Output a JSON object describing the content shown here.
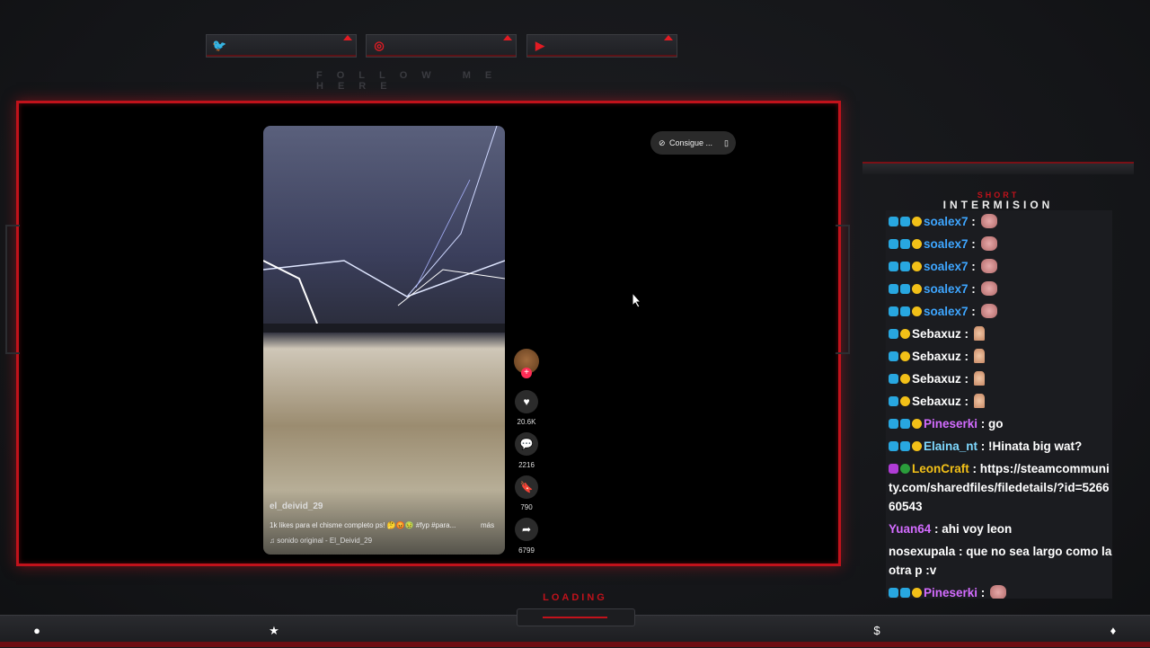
{
  "overlay": {
    "follow_text": "FOLLOW ME HERE",
    "loading_text": "LOADING",
    "chat_header_small": "SHORT",
    "chat_header": "INTERMISION",
    "socials": [
      {
        "icon": "twitter-icon",
        "glyph": "🐦"
      },
      {
        "icon": "instagram-icon",
        "glyph": "◎"
      },
      {
        "icon": "youtube-icon",
        "glyph": "▶"
      }
    ],
    "accent_color": "#c1121b"
  },
  "video": {
    "username": "el_deivid_29",
    "caption": "1k likes para el chisme completo ps! 🤔😡🤢 #fyp #para...",
    "more": "más",
    "sound": "♫  sonido original - El_Deivid_29",
    "likes": "20.6K",
    "comments": "2216",
    "saves": "790",
    "shares": "6799",
    "pill_text": "Consigue ..."
  },
  "chat": {
    "messages": [
      {
        "user": "soalex7",
        "color": "#3ea6ff",
        "badges": [
          "blue",
          "blue",
          "gold"
        ],
        "text": "",
        "emote": "face"
      },
      {
        "user": "soalex7",
        "color": "#3ea6ff",
        "badges": [
          "blue",
          "blue",
          "gold"
        ],
        "text": "",
        "emote": "face"
      },
      {
        "user": "soalex7",
        "color": "#3ea6ff",
        "badges": [
          "blue",
          "blue",
          "gold"
        ],
        "text": "",
        "emote": "face"
      },
      {
        "user": "soalex7",
        "color": "#3ea6ff",
        "badges": [
          "blue",
          "blue",
          "gold"
        ],
        "text": "",
        "emote": "face"
      },
      {
        "user": "soalex7",
        "color": "#3ea6ff",
        "badges": [
          "blue",
          "blue",
          "gold"
        ],
        "text": "",
        "emote": "face"
      },
      {
        "user": "Sebaxuz",
        "color": "#ffffff",
        "badges": [
          "blue",
          "gold"
        ],
        "text": "",
        "emote": "hand"
      },
      {
        "user": "Sebaxuz",
        "color": "#ffffff",
        "badges": [
          "blue",
          "gold"
        ],
        "text": "",
        "emote": "hand"
      },
      {
        "user": "Sebaxuz",
        "color": "#ffffff",
        "badges": [
          "blue",
          "gold"
        ],
        "text": "",
        "emote": "hand"
      },
      {
        "user": "Sebaxuz",
        "color": "#ffffff",
        "badges": [
          "blue",
          "gold"
        ],
        "text": "",
        "emote": "hand"
      },
      {
        "user": "Pineserki",
        "color": "#d36cff",
        "badges": [
          "blue",
          "blue",
          "gold"
        ],
        "text": "go",
        "emote": ""
      },
      {
        "user": "Elaina_nt",
        "color": "#7fd9ff",
        "badges": [
          "blue",
          "blue",
          "gold"
        ],
        "text": "!Hinata big wat?",
        "emote": ""
      },
      {
        "user": "LeonCraft",
        "color": "#f2c018",
        "badges": [
          "mic",
          "green"
        ],
        "text": "https://steamcommunity.com/sharedfiles/filedetails/?id=526660543",
        "emote": ""
      },
      {
        "user": "Yuan64",
        "color": "#d36cff",
        "badges": [],
        "text": "ahi voy leon",
        "emote": ""
      },
      {
        "user": "nosexupala",
        "color": "#ffffff",
        "badges": [],
        "text": "que no sea largo como la otra p :v",
        "emote": ""
      },
      {
        "user": "Pineserki",
        "color": "#d36cff",
        "badges": [
          "blue",
          "blue",
          "gold"
        ],
        "text": "",
        "emote": "face"
      }
    ]
  },
  "bottom_bar": {
    "icons": [
      "user-icon",
      "star-icon",
      "dollar-icon",
      "drop-icon"
    ],
    "glyphs": [
      "👤",
      "★",
      "$",
      "💧"
    ]
  }
}
